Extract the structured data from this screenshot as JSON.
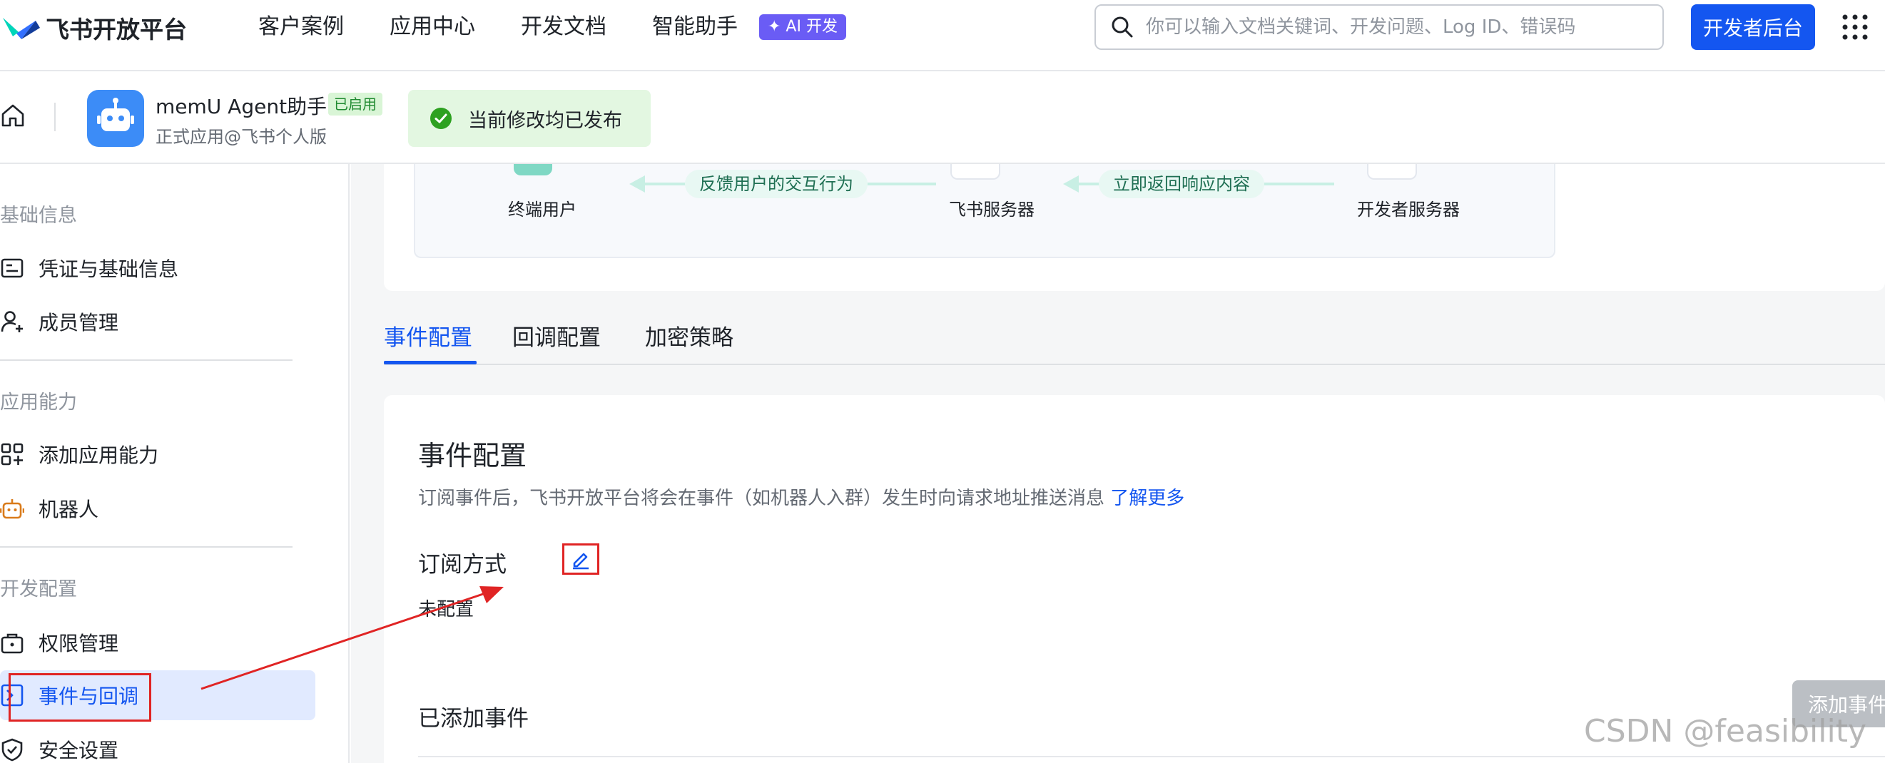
{
  "topnav": {
    "logo_text": "飞书开放平台",
    "items": [
      "客户案例",
      "应用中心",
      "开发文档",
      "智能助手"
    ],
    "ai_badge": "✦ AI 开发",
    "search_placeholder": "你可以输入文档关键词、开发问题、Log ID、错误码",
    "dev_console": "开发者后台"
  },
  "appbar": {
    "app_name": "memU Agent助手",
    "status": "已启用",
    "app_sub": "正式应用@飞书个人版",
    "publish_msg": "当前修改均已发布"
  },
  "sidebar": {
    "groups": [
      "基础信息",
      "应用能力",
      "开发配置"
    ],
    "items": [
      "凭证与基础信息",
      "成员管理",
      "添加应用能力",
      "机器人",
      "权限管理",
      "事件与回调",
      "安全设置"
    ]
  },
  "flow": {
    "nodes": [
      "终端用户",
      "飞书服务器",
      "开发者服务器"
    ],
    "pills": [
      "反馈用户的交互行为",
      "立即返回响应内容"
    ]
  },
  "tabs": [
    "事件配置",
    "回调配置",
    "加密策略"
  ],
  "event_config": {
    "title": "事件配置",
    "desc": "订阅事件后，飞书开放平台将会在事件（如机器人入群）发生时向请求地址推送消息",
    "learn_more": "了解更多",
    "subscribe_label": "订阅方式",
    "subscribe_value": "未配置",
    "added_title": "已添加事件",
    "add_button": "添加事件"
  },
  "watermark": "CSDN @feasibility",
  "colors": {
    "accent": "#1456f0",
    "annotation": "#e02424",
    "success": "#1f8a30"
  }
}
